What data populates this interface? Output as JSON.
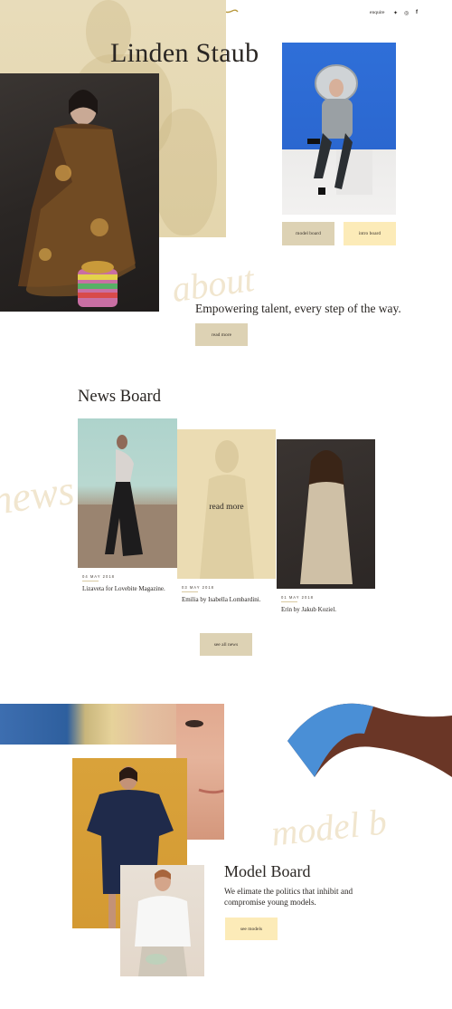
{
  "header": {
    "menu_icon": "hamburger-icon",
    "logo_icon": "brand-mark-icon",
    "enquire_label": "enquire",
    "social_icons": [
      "twitter-icon",
      "instagram-icon",
      "facebook-icon"
    ],
    "social_glyphs": [
      "✦",
      "◎",
      "f"
    ]
  },
  "hero": {
    "title": "Linden Staub",
    "buttons": {
      "model_board": "model board",
      "intro_board": "intro board"
    },
    "script_word": "about",
    "tagline": "Empowering talent, every step of the way.",
    "read_more": "read more"
  },
  "news": {
    "title": "News Board",
    "script_word": "news",
    "overlay_label": "read more",
    "items": [
      {
        "date": "04 MAY 2018",
        "caption": "Lizaveta for Lovebite Magazine."
      },
      {
        "date": "03 MAY 2018",
        "caption": "Emilia by Isabella Lombardini."
      },
      {
        "date": "01 MAY 2018",
        "caption": "Erin by Jakub Koziel."
      }
    ],
    "see_all": "see all news"
  },
  "model_board": {
    "script_word": "model b",
    "title": "Model Board",
    "description": "We elimate the politics that inhibit and compromise young models.",
    "see_models": "see models"
  },
  "colors": {
    "accent_tan": "#ddd2b4",
    "accent_cream": "#fcebb8",
    "hero_bg": "#e8dcba",
    "text": "#2a2623"
  }
}
